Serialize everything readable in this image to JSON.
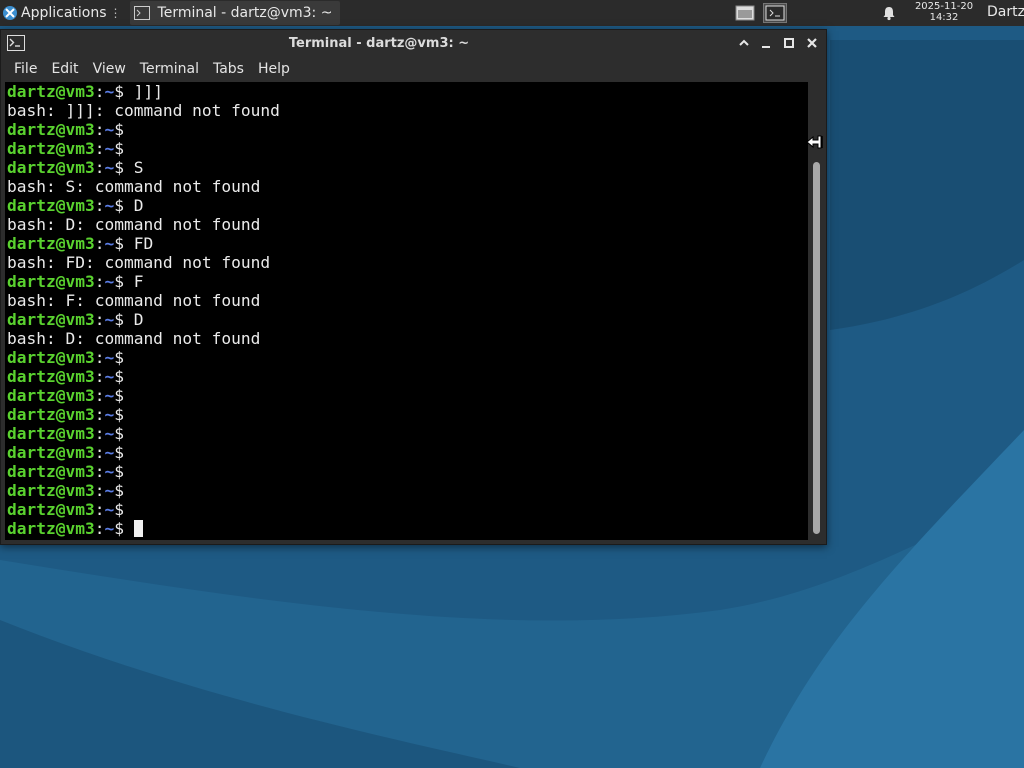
{
  "panel": {
    "applications_label": "Applications",
    "task_title": "Terminal - dartz@vm3: ~",
    "date": "2025-11-20",
    "time": "14:32",
    "user": "Dartz"
  },
  "window": {
    "title": "Terminal - dartz@vm3: ~",
    "menu": [
      "File",
      "Edit",
      "View",
      "Terminal",
      "Tabs",
      "Help"
    ]
  },
  "terminal": {
    "prompt_user": "dartz@vm3",
    "prompt_sep": ":",
    "prompt_path": "~",
    "prompt_symbol": "$",
    "lines": [
      {
        "type": "prompt",
        "cmd": " ]]]"
      },
      {
        "type": "output",
        "text": "bash: ]]]: command not found"
      },
      {
        "type": "prompt",
        "cmd": ""
      },
      {
        "type": "prompt",
        "cmd": ""
      },
      {
        "type": "prompt",
        "cmd": " S"
      },
      {
        "type": "output",
        "text": "bash: S: command not found"
      },
      {
        "type": "prompt",
        "cmd": " D"
      },
      {
        "type": "output",
        "text": "bash: D: command not found"
      },
      {
        "type": "prompt",
        "cmd": " FD"
      },
      {
        "type": "output",
        "text": "bash: FD: command not found"
      },
      {
        "type": "prompt",
        "cmd": " F"
      },
      {
        "type": "output",
        "text": "bash: F: command not found"
      },
      {
        "type": "prompt",
        "cmd": " D"
      },
      {
        "type": "output",
        "text": "bash: D: command not found"
      },
      {
        "type": "prompt",
        "cmd": ""
      },
      {
        "type": "prompt",
        "cmd": ""
      },
      {
        "type": "prompt",
        "cmd": ""
      },
      {
        "type": "prompt",
        "cmd": ""
      },
      {
        "type": "prompt",
        "cmd": ""
      },
      {
        "type": "prompt",
        "cmd": ""
      },
      {
        "type": "prompt",
        "cmd": ""
      },
      {
        "type": "prompt",
        "cmd": ""
      },
      {
        "type": "prompt",
        "cmd": ""
      },
      {
        "type": "prompt",
        "cmd": " ",
        "cursor": true
      }
    ]
  },
  "colors": {
    "prompt_user": "#5ad22f",
    "prompt_path": "#5b7de5",
    "desktop": "#1f5c86"
  },
  "icons": [
    "xfce-logo-icon",
    "terminal-icon",
    "workspace-icon",
    "notification-bell-icon",
    "minimize-icon",
    "maximize-icon",
    "close-icon",
    "shade-icon",
    "resize-pointer-icon"
  ]
}
